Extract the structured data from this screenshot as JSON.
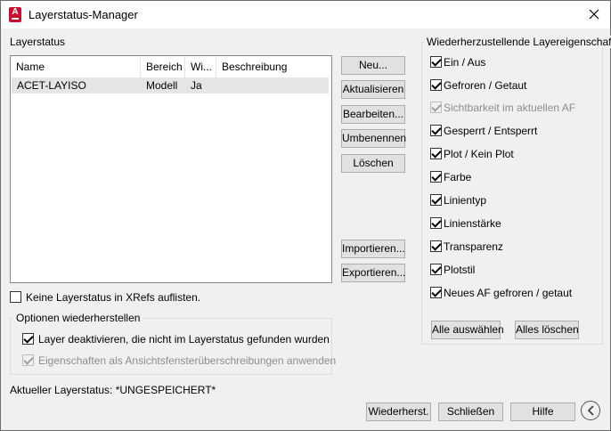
{
  "window": {
    "title": "Layerstatus-Manager",
    "accent_color": "#c8102e",
    "close_icon": "close-icon"
  },
  "layer_states": {
    "group_label": "Layerstatus",
    "columns": [
      "Name",
      "Bereich",
      "Wi...",
      "Beschreibung"
    ],
    "rows": [
      {
        "name": "ACET-LAYISO",
        "bereich": "Modell",
        "wi": "Ja",
        "beschreibung": ""
      }
    ]
  },
  "action_buttons": {
    "neu": "Neu...",
    "aktualisieren": "Aktualisieren",
    "bearbeiten": "Bearbeiten...",
    "umbenennen": "Umbenennen",
    "loeschen": "Löschen",
    "importieren": "Importieren...",
    "exportieren": "Exportieren..."
  },
  "xref_option": {
    "label": "Keine Layerstatus in XRefs auflisten.",
    "checked": false
  },
  "restore_options": {
    "group_label": "Optionen wiederherstellen",
    "deactivate": {
      "label": "Layer deaktivieren, die nicht im Layerstatus gefunden wurden",
      "checked": true
    },
    "overrides": {
      "label": "Eigenschaften als Ansichtsfensterüberschreibungen anwenden",
      "checked": true,
      "disabled": true
    }
  },
  "current_state": "Aktueller Layerstatus: *UNGESPEICHERT*",
  "properties": {
    "group_label": "Wiederherzustellende Layereigenschaften",
    "items": [
      {
        "label": "Ein / Aus",
        "checked": true,
        "disabled": false
      },
      {
        "label": "Gefroren / Getaut",
        "checked": true,
        "disabled": false
      },
      {
        "label": "Sichtbarkeit im aktuellen AF",
        "checked": true,
        "disabled": true
      },
      {
        "label": "Gesperrt / Entsperrt",
        "checked": true,
        "disabled": false
      },
      {
        "label": "Plot / Kein Plot",
        "checked": true,
        "disabled": false
      },
      {
        "label": "Farbe",
        "checked": true,
        "disabled": false
      },
      {
        "label": "Linientyp",
        "checked": true,
        "disabled": false
      },
      {
        "label": "Linienstärke",
        "checked": true,
        "disabled": false
      },
      {
        "label": "Transparenz",
        "checked": true,
        "disabled": false
      },
      {
        "label": "Plotstil",
        "checked": true,
        "disabled": false
      },
      {
        "label": "Neues AF gefroren / getaut",
        "checked": true,
        "disabled": false
      }
    ],
    "select_all": "Alle auswählen",
    "clear_all": "Alles löschen"
  },
  "footer": {
    "restore": "Wiederherst.",
    "close": "Schließen",
    "help": "Hilfe",
    "nav_icon": "chevron-left-circle-icon"
  }
}
